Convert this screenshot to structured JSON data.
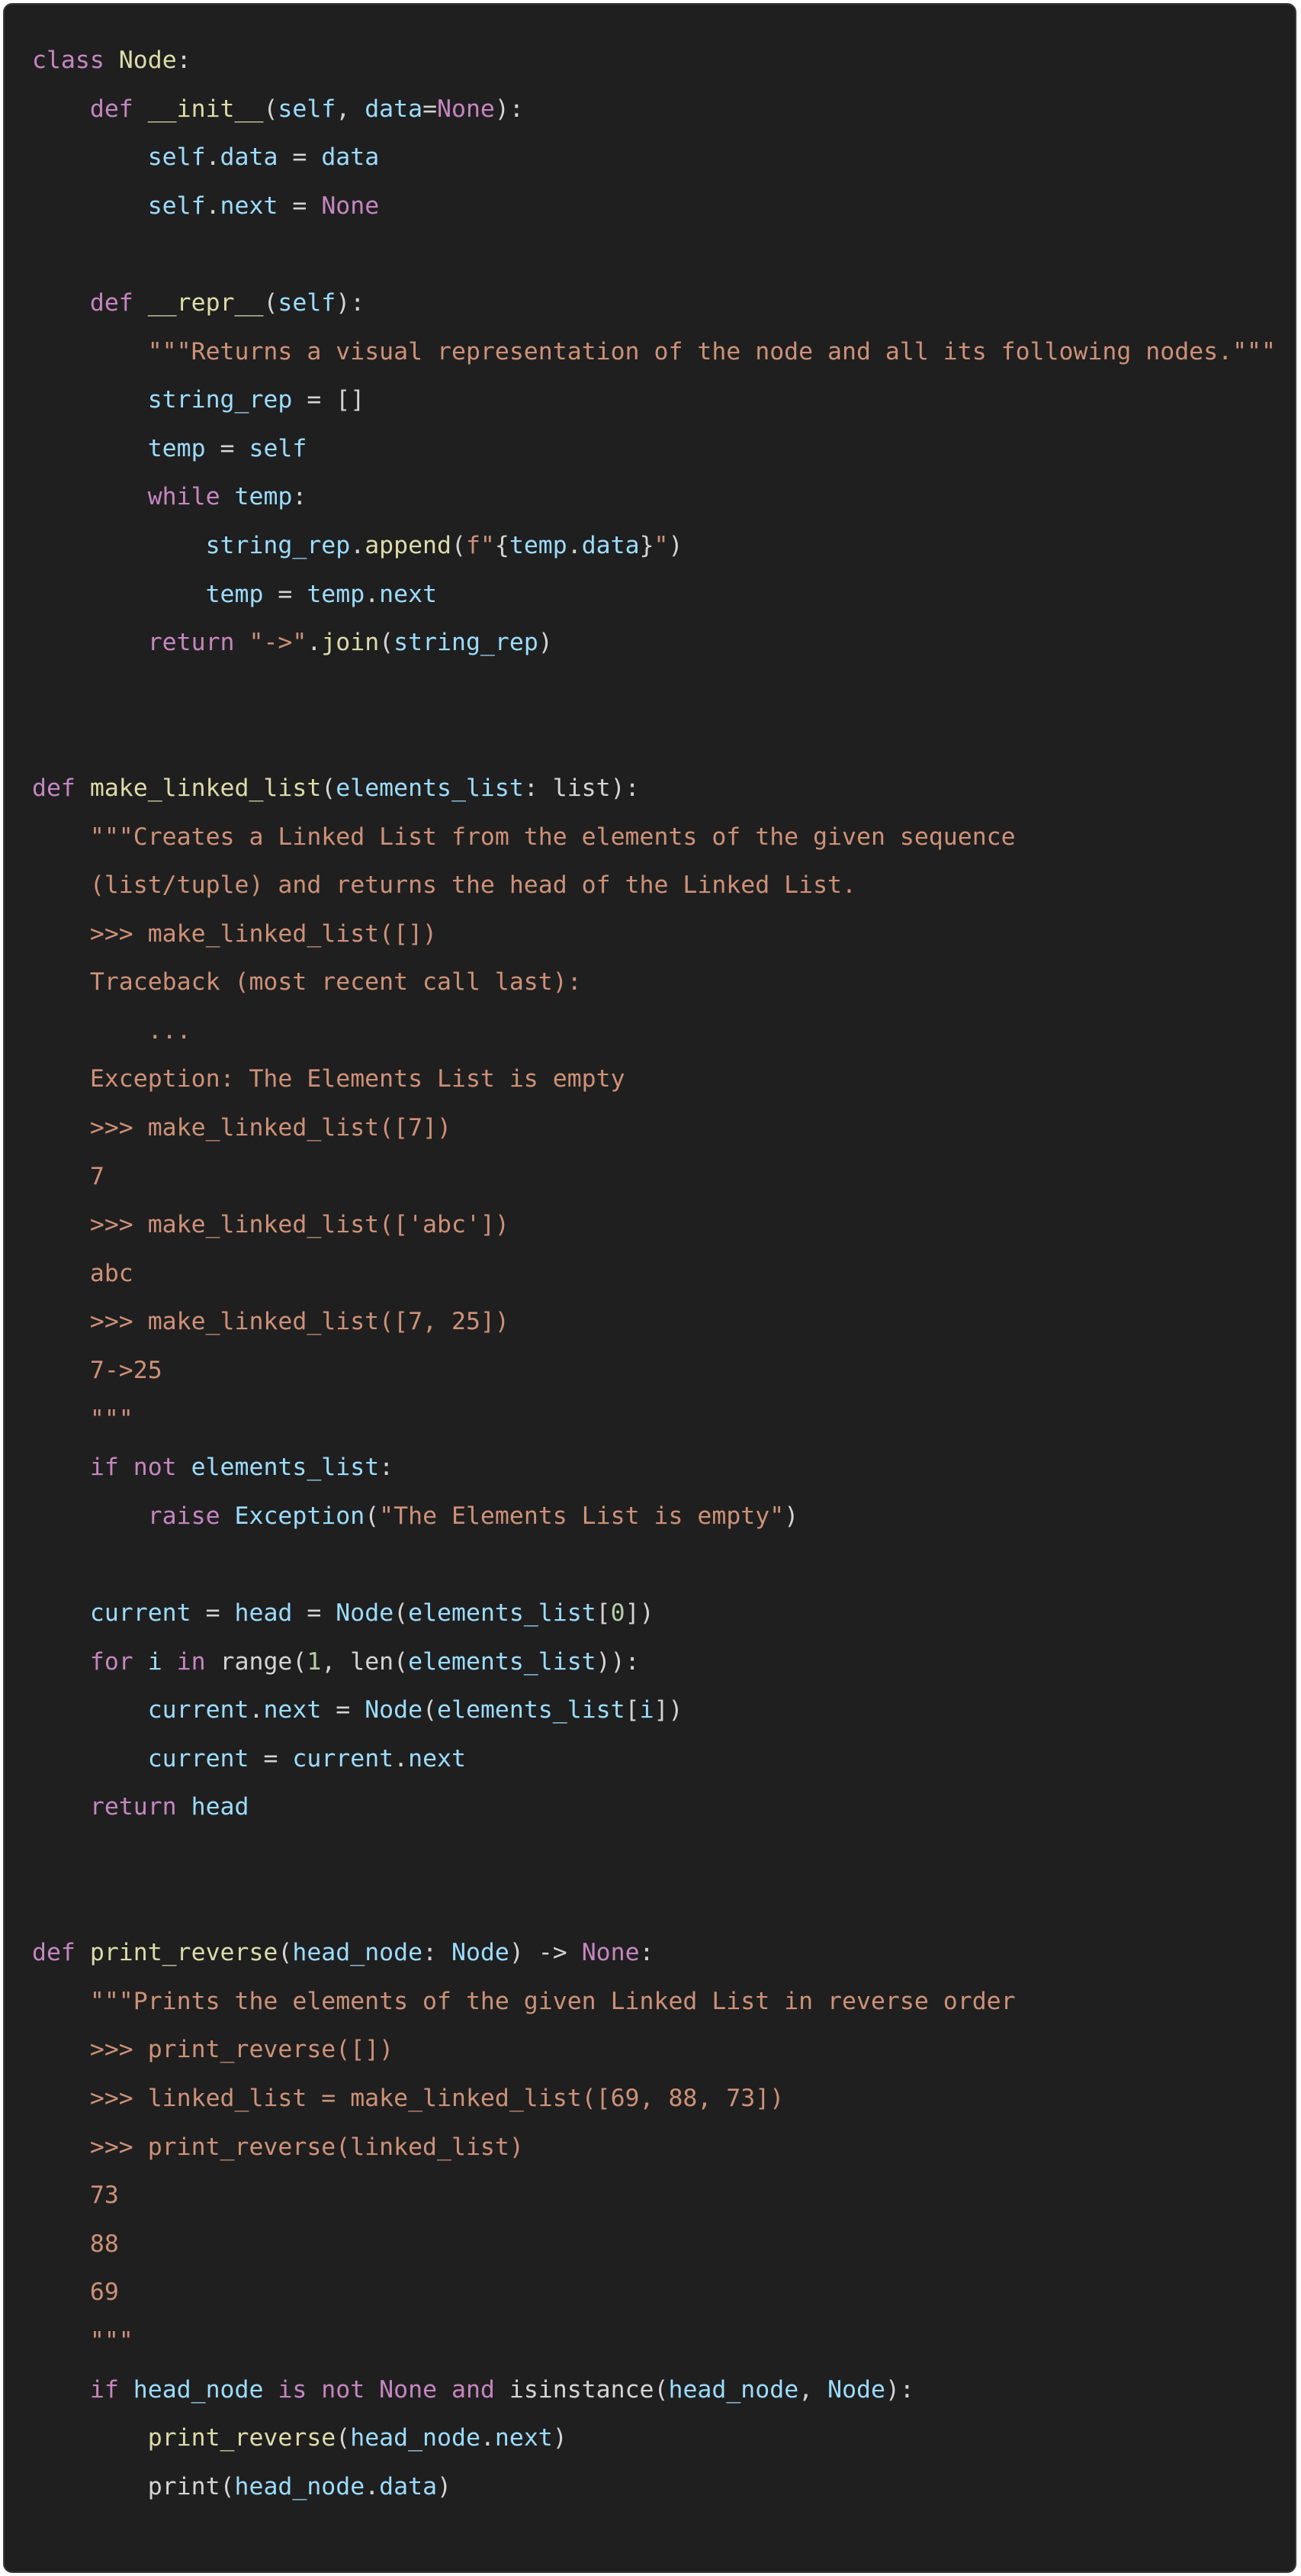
{
  "editor": {
    "background": "#1f1f1f",
    "theme_colors": {
      "keyword": "#c586c0",
      "function": "#dcdcaa",
      "variable": "#9cdcfe",
      "string": "#ce9178",
      "number": "#b5cea8",
      "plain": "#d4d4d4"
    },
    "lines": [
      [
        [
          "kw",
          "class "
        ],
        [
          "name",
          "Node"
        ],
        [
          "plain",
          ":"
        ]
      ],
      [
        [
          "plain",
          "    "
        ],
        [
          "kw",
          "def "
        ],
        [
          "name",
          "__init__"
        ],
        [
          "plain",
          "("
        ],
        [
          "var",
          "self"
        ],
        [
          "plain",
          ", "
        ],
        [
          "var",
          "data"
        ],
        [
          "plain",
          "="
        ],
        [
          "kw",
          "None"
        ],
        [
          "plain",
          "):"
        ]
      ],
      [
        [
          "plain",
          "        "
        ],
        [
          "var",
          "self"
        ],
        [
          "plain",
          "."
        ],
        [
          "var",
          "data"
        ],
        [
          "plain",
          " = "
        ],
        [
          "var",
          "data"
        ]
      ],
      [
        [
          "plain",
          "        "
        ],
        [
          "var",
          "self"
        ],
        [
          "plain",
          "."
        ],
        [
          "var",
          "next"
        ],
        [
          "plain",
          " = "
        ],
        [
          "kw",
          "None"
        ]
      ],
      [],
      [
        [
          "plain",
          "    "
        ],
        [
          "kw",
          "def "
        ],
        [
          "name",
          "__repr__"
        ],
        [
          "plain",
          "("
        ],
        [
          "var",
          "self"
        ],
        [
          "plain",
          "):"
        ]
      ],
      [
        [
          "plain",
          "        "
        ],
        [
          "str",
          "\"\"\"Returns a visual representation of the node and all its following nodes.\"\"\""
        ]
      ],
      [
        [
          "plain",
          "        "
        ],
        [
          "var",
          "string_rep"
        ],
        [
          "plain",
          " = []"
        ]
      ],
      [
        [
          "plain",
          "        "
        ],
        [
          "var",
          "temp"
        ],
        [
          "plain",
          " = "
        ],
        [
          "var",
          "self"
        ]
      ],
      [
        [
          "plain",
          "        "
        ],
        [
          "kw",
          "while "
        ],
        [
          "var",
          "temp"
        ],
        [
          "plain",
          ":"
        ]
      ],
      [
        [
          "plain",
          "            "
        ],
        [
          "var",
          "string_rep"
        ],
        [
          "plain",
          "."
        ],
        [
          "name",
          "append"
        ],
        [
          "plain",
          "("
        ],
        [
          "str",
          "f\""
        ],
        [
          "plain",
          "{"
        ],
        [
          "var",
          "temp"
        ],
        [
          "plain",
          "."
        ],
        [
          "var",
          "data"
        ],
        [
          "plain",
          "}"
        ],
        [
          "str",
          "\""
        ],
        [
          "plain",
          ")"
        ]
      ],
      [
        [
          "plain",
          "            "
        ],
        [
          "var",
          "temp"
        ],
        [
          "plain",
          " = "
        ],
        [
          "var",
          "temp"
        ],
        [
          "plain",
          "."
        ],
        [
          "var",
          "next"
        ]
      ],
      [
        [
          "plain",
          "        "
        ],
        [
          "kw",
          "return "
        ],
        [
          "str",
          "\"->\""
        ],
        [
          "plain",
          "."
        ],
        [
          "name",
          "join"
        ],
        [
          "plain",
          "("
        ],
        [
          "var",
          "string_rep"
        ],
        [
          "plain",
          ")"
        ]
      ],
      [],
      [],
      [
        [
          "kw",
          "def "
        ],
        [
          "name",
          "make_linked_list"
        ],
        [
          "plain",
          "("
        ],
        [
          "var",
          "elements_list"
        ],
        [
          "plain",
          ": "
        ],
        [
          "plain",
          "list"
        ],
        [
          "plain",
          "):"
        ]
      ],
      [
        [
          "plain",
          "    "
        ],
        [
          "str",
          "\"\"\"Creates a Linked List from the elements of the given sequence"
        ]
      ],
      [
        [
          "plain",
          "    "
        ],
        [
          "str",
          "(list/tuple) and returns the head of the Linked List."
        ]
      ],
      [
        [
          "plain",
          "    "
        ],
        [
          "str",
          ">>> make_linked_list([])"
        ]
      ],
      [
        [
          "plain",
          "    "
        ],
        [
          "str",
          "Traceback (most recent call last):"
        ]
      ],
      [
        [
          "plain",
          "        "
        ],
        [
          "str",
          "..."
        ]
      ],
      [
        [
          "plain",
          "    "
        ],
        [
          "str",
          "Exception: The Elements List is empty"
        ]
      ],
      [
        [
          "plain",
          "    "
        ],
        [
          "str",
          ">>> make_linked_list([7])"
        ]
      ],
      [
        [
          "plain",
          "    "
        ],
        [
          "str",
          "7"
        ]
      ],
      [
        [
          "plain",
          "    "
        ],
        [
          "str",
          ">>> make_linked_list(['abc'])"
        ]
      ],
      [
        [
          "plain",
          "    "
        ],
        [
          "str",
          "abc"
        ]
      ],
      [
        [
          "plain",
          "    "
        ],
        [
          "str",
          ">>> make_linked_list([7, 25])"
        ]
      ],
      [
        [
          "plain",
          "    "
        ],
        [
          "str",
          "7->25"
        ]
      ],
      [
        [
          "plain",
          "    "
        ],
        [
          "str",
          "\"\"\""
        ]
      ],
      [
        [
          "plain",
          "    "
        ],
        [
          "kw",
          "if not "
        ],
        [
          "var",
          "elements_list"
        ],
        [
          "plain",
          ":"
        ]
      ],
      [
        [
          "plain",
          "        "
        ],
        [
          "kw",
          "raise "
        ],
        [
          "var",
          "Exception"
        ],
        [
          "plain",
          "("
        ],
        [
          "str",
          "\"The Elements List is empty\""
        ],
        [
          "plain",
          ")"
        ]
      ],
      [],
      [
        [
          "plain",
          "    "
        ],
        [
          "var",
          "current"
        ],
        [
          "plain",
          " = "
        ],
        [
          "var",
          "head"
        ],
        [
          "plain",
          " = "
        ],
        [
          "var",
          "Node"
        ],
        [
          "plain",
          "("
        ],
        [
          "var",
          "elements_list"
        ],
        [
          "plain",
          "["
        ],
        [
          "num",
          "0"
        ],
        [
          "plain",
          "])"
        ]
      ],
      [
        [
          "plain",
          "    "
        ],
        [
          "kw",
          "for "
        ],
        [
          "var",
          "i"
        ],
        [
          "kw",
          " in "
        ],
        [
          "plain",
          "range("
        ],
        [
          "num",
          "1"
        ],
        [
          "plain",
          ", len("
        ],
        [
          "var",
          "elements_list"
        ],
        [
          "plain",
          ")):"
        ]
      ],
      [
        [
          "plain",
          "        "
        ],
        [
          "var",
          "current"
        ],
        [
          "plain",
          "."
        ],
        [
          "var",
          "next"
        ],
        [
          "plain",
          " = "
        ],
        [
          "var",
          "Node"
        ],
        [
          "plain",
          "("
        ],
        [
          "var",
          "elements_list"
        ],
        [
          "plain",
          "["
        ],
        [
          "var",
          "i"
        ],
        [
          "plain",
          "])"
        ]
      ],
      [
        [
          "plain",
          "        "
        ],
        [
          "var",
          "current"
        ],
        [
          "plain",
          " = "
        ],
        [
          "var",
          "current"
        ],
        [
          "plain",
          "."
        ],
        [
          "var",
          "next"
        ]
      ],
      [
        [
          "plain",
          "    "
        ],
        [
          "kw",
          "return "
        ],
        [
          "var",
          "head"
        ]
      ],
      [],
      [],
      [
        [
          "kw",
          "def "
        ],
        [
          "name",
          "print_reverse"
        ],
        [
          "plain",
          "("
        ],
        [
          "var",
          "head_node"
        ],
        [
          "plain",
          ": "
        ],
        [
          "var",
          "Node"
        ],
        [
          "plain",
          ") -> "
        ],
        [
          "kw",
          "None"
        ],
        [
          "plain",
          ":"
        ]
      ],
      [
        [
          "plain",
          "    "
        ],
        [
          "str",
          "\"\"\"Prints the elements of the given Linked List in reverse order"
        ]
      ],
      [
        [
          "plain",
          "    "
        ],
        [
          "str",
          ">>> print_reverse([])"
        ]
      ],
      [
        [
          "plain",
          "    "
        ],
        [
          "str",
          ">>> linked_list = make_linked_list([69, 88, 73])"
        ]
      ],
      [
        [
          "plain",
          "    "
        ],
        [
          "str",
          ">>> print_reverse(linked_list)"
        ]
      ],
      [
        [
          "plain",
          "    "
        ],
        [
          "str",
          "73"
        ]
      ],
      [
        [
          "plain",
          "    "
        ],
        [
          "str",
          "88"
        ]
      ],
      [
        [
          "plain",
          "    "
        ],
        [
          "str",
          "69"
        ]
      ],
      [
        [
          "plain",
          "    "
        ],
        [
          "str",
          "\"\"\""
        ]
      ],
      [
        [
          "plain",
          "    "
        ],
        [
          "kw",
          "if "
        ],
        [
          "var",
          "head_node"
        ],
        [
          "kw",
          " is not "
        ],
        [
          "kw",
          "None"
        ],
        [
          "kw",
          " and "
        ],
        [
          "plain",
          "isinstance("
        ],
        [
          "var",
          "head_node"
        ],
        [
          "plain",
          ", "
        ],
        [
          "var",
          "Node"
        ],
        [
          "plain",
          "):"
        ]
      ],
      [
        [
          "plain",
          "        "
        ],
        [
          "name",
          "print_reverse"
        ],
        [
          "plain",
          "("
        ],
        [
          "var",
          "head_node"
        ],
        [
          "plain",
          "."
        ],
        [
          "var",
          "next"
        ],
        [
          "plain",
          ")"
        ]
      ],
      [
        [
          "plain",
          "        "
        ],
        [
          "plain",
          "print("
        ],
        [
          "var",
          "head_node"
        ],
        [
          "plain",
          "."
        ],
        [
          "var",
          "data"
        ],
        [
          "plain",
          ")"
        ]
      ]
    ]
  }
}
